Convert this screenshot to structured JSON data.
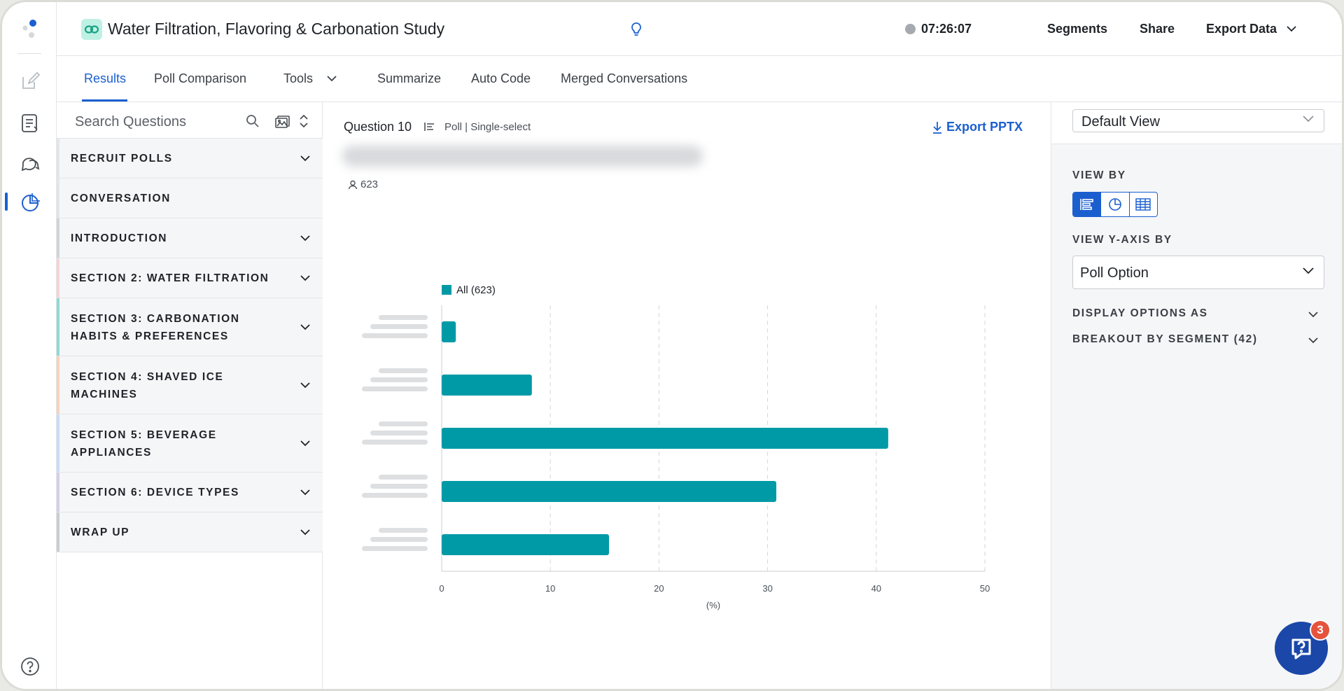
{
  "header": {
    "study_title": "Water Filtration, Flavoring & Carbonation Study",
    "timer": "07:26:07",
    "segments_label": "Segments",
    "share_label": "Share",
    "export_data_label": "Export Data"
  },
  "tabs": [
    {
      "label": "Results"
    },
    {
      "label": "Poll Comparison"
    },
    {
      "label": "Tools"
    },
    {
      "label": "Summarize"
    },
    {
      "label": "Auto Code"
    },
    {
      "label": "Merged Conversations"
    }
  ],
  "sidebar": {
    "search_placeholder": "Search Questions",
    "sections": [
      {
        "line1": "RECRUIT POLLS",
        "line2": "",
        "accent": "#e3e5e8"
      },
      {
        "line1": "CONVERSATION",
        "line2": "",
        "accent": "#e3e5e8"
      },
      {
        "line1": "INTRODUCTION",
        "line2": "",
        "accent": "#d0d3d8"
      },
      {
        "line1": "SECTION 2: WATER FILTRATION",
        "line2": "",
        "accent": "#f6d3d6"
      },
      {
        "line1": "SECTION 3: CARBONATION",
        "line2": "HABITS & PREFERENCES",
        "accent": "#8fd8d2"
      },
      {
        "line1": "SECTION 4: SHAVED ICE",
        "line2": "MACHINES",
        "accent": "#f7d2b8"
      },
      {
        "line1": "SECTION 5: BEVERAGE",
        "line2": "APPLIANCES",
        "accent": "#c7dcf4"
      },
      {
        "line1": "SECTION 6: DEVICE TYPES",
        "line2": "",
        "accent": "#d6cdea"
      },
      {
        "line1": "WRAP UP",
        "line2": "",
        "accent": "#c9ccd1"
      }
    ]
  },
  "question": {
    "number": "Question 10",
    "type": "Poll | Single-select",
    "export_label": "Export PPTX",
    "respondents": "623"
  },
  "chart_data": {
    "type": "bar",
    "orientation": "horizontal",
    "legend": "All (623)",
    "legend_placement": "top-left",
    "bar_color": "#009aa6",
    "values": [
      1.3,
      8.3,
      41.1,
      30.8,
      15.4
    ],
    "xlim": [
      0,
      50
    ],
    "xticks": [
      "0",
      "10",
      "20",
      "30",
      "40",
      "50"
    ],
    "xlabel": "(%)",
    "grid": true
  },
  "right_panel": {
    "default_view": "Default View",
    "view_by_label": "VIEW BY",
    "view_y_label": "VIEW Y-AXIS BY",
    "view_y_value": "Poll Option",
    "display_options_label": "DISPLAY OPTIONS AS",
    "breakout_label": "BREAKOUT BY SEGMENT (42)"
  },
  "chat_badge": "3",
  "colors": {
    "accent": "#1b5fcf",
    "bar": "#009aa6"
  }
}
